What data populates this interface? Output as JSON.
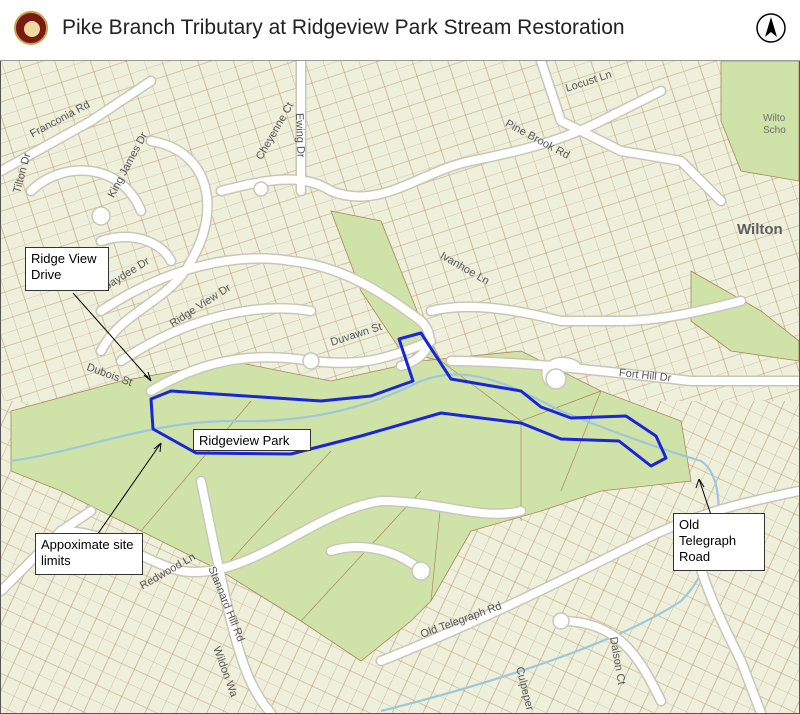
{
  "header": {
    "title": "Pike Branch Tributary at Ridgeview Park Stream Restoration",
    "logo_icon": "county-seal-icon",
    "north_icon": "north-arrow-icon"
  },
  "map": {
    "colors": {
      "background": "#eef0dc",
      "park": "#cfe3a8",
      "parcel_line": "#a9865d",
      "road": "#ffffff",
      "stream": "#9ec8d9",
      "site_boundary": "#1a24d8"
    },
    "callouts": {
      "ridge_view_drive": "Ridge View Drive",
      "ridgeview_park": "Ridgeview Park",
      "site_limits": "Appoximate site limits",
      "old_telegraph": "Old Telegraph Road"
    },
    "place_labels": {
      "wilton": "Wilton",
      "wilton_school_a": "Wilto",
      "wilton_school_b": "Scho"
    },
    "road_labels": {
      "franconia": "Franconia Rd",
      "king_james": "King James Dr",
      "cheyenne": "Cheyenne Ct",
      "ewing": "Ewing Dr",
      "locust": "Locust Ln",
      "pine_brook": "Pine Brook Rd",
      "jaydee": "Jaydee Dr",
      "ivanhoe": "Ivanhoe Ln",
      "ridge_view_dr": "Ridge View Dr",
      "duvawn": "Duvawn St",
      "dubois": "Dubois St",
      "fort_hill": "Fort Hill Dr",
      "redwood": "Redwood Ln",
      "stannard_hill": "Stannard Hill Rd",
      "wildon": "Wildon Wa",
      "old_telegraph": "Old Telegraph Rd",
      "dalson": "Dalson Ct",
      "culpeper": "Culpeper Ct",
      "tilton": "Tilton Dr"
    }
  }
}
